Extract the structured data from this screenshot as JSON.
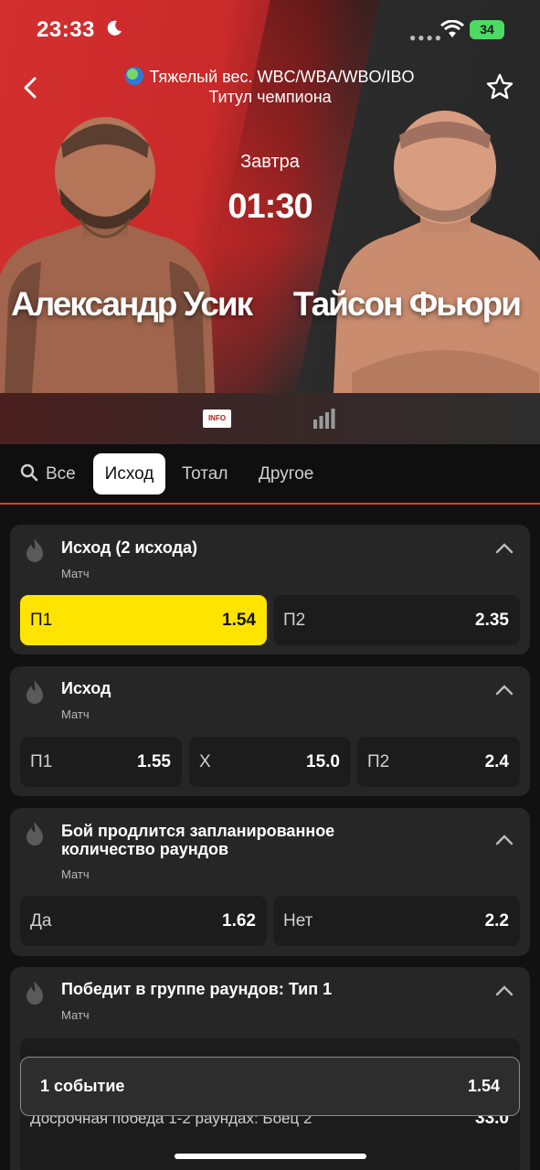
{
  "status_bar": {
    "time": "23:33",
    "battery": "34"
  },
  "header": {
    "event_title_line1": "Тяжелый вес. WBC/WBA/WBO/IBO",
    "event_title_line2": "Титул чемпиона",
    "date_label": "Завтра",
    "start_time": "01:30"
  },
  "fighters": {
    "fighter1": "Александр Усик",
    "fighter2": "Тайсон Фьюри"
  },
  "info_strip": {
    "info_label": "INFO"
  },
  "filters": {
    "all": "Все",
    "outcome": "Исход",
    "total": "Тотал",
    "other": "Другое",
    "selected": "Исход"
  },
  "markets": [
    {
      "title": "Исход (2 исхода)",
      "subtitle": "Матч",
      "odds": [
        {
          "label": "П1",
          "value": "1.54",
          "selected": true
        },
        {
          "label": "П2",
          "value": "2.35",
          "selected": false
        }
      ]
    },
    {
      "title": "Исход",
      "subtitle": "Матч",
      "odds": [
        {
          "label": "П1",
          "value": "1.55"
        },
        {
          "label": "Х",
          "value": "15.0"
        },
        {
          "label": "П2",
          "value": "2.4"
        }
      ]
    },
    {
      "title_line1": "Бой продлится запланированное",
      "title_line2": "количество раундов",
      "subtitle": "Матч",
      "odds": [
        {
          "label": "Да",
          "value": "1.62"
        },
        {
          "label": "Нет",
          "value": "2.2"
        }
      ]
    },
    {
      "title": "Победит в группе раундов: Тип 1",
      "subtitle": "Матч",
      "rows": [
        {
          "label": "Досрочная победа 1-2 раундах: Боец 2",
          "value": "33.0"
        }
      ]
    }
  ],
  "betslip": {
    "count_label": "1 событие",
    "total_odds": "1.54"
  },
  "colors": {
    "selected_odd": "#ffe400",
    "accent_red": "#d42f2f",
    "card": "#262626",
    "odd_cell": "#1c1c1c"
  }
}
